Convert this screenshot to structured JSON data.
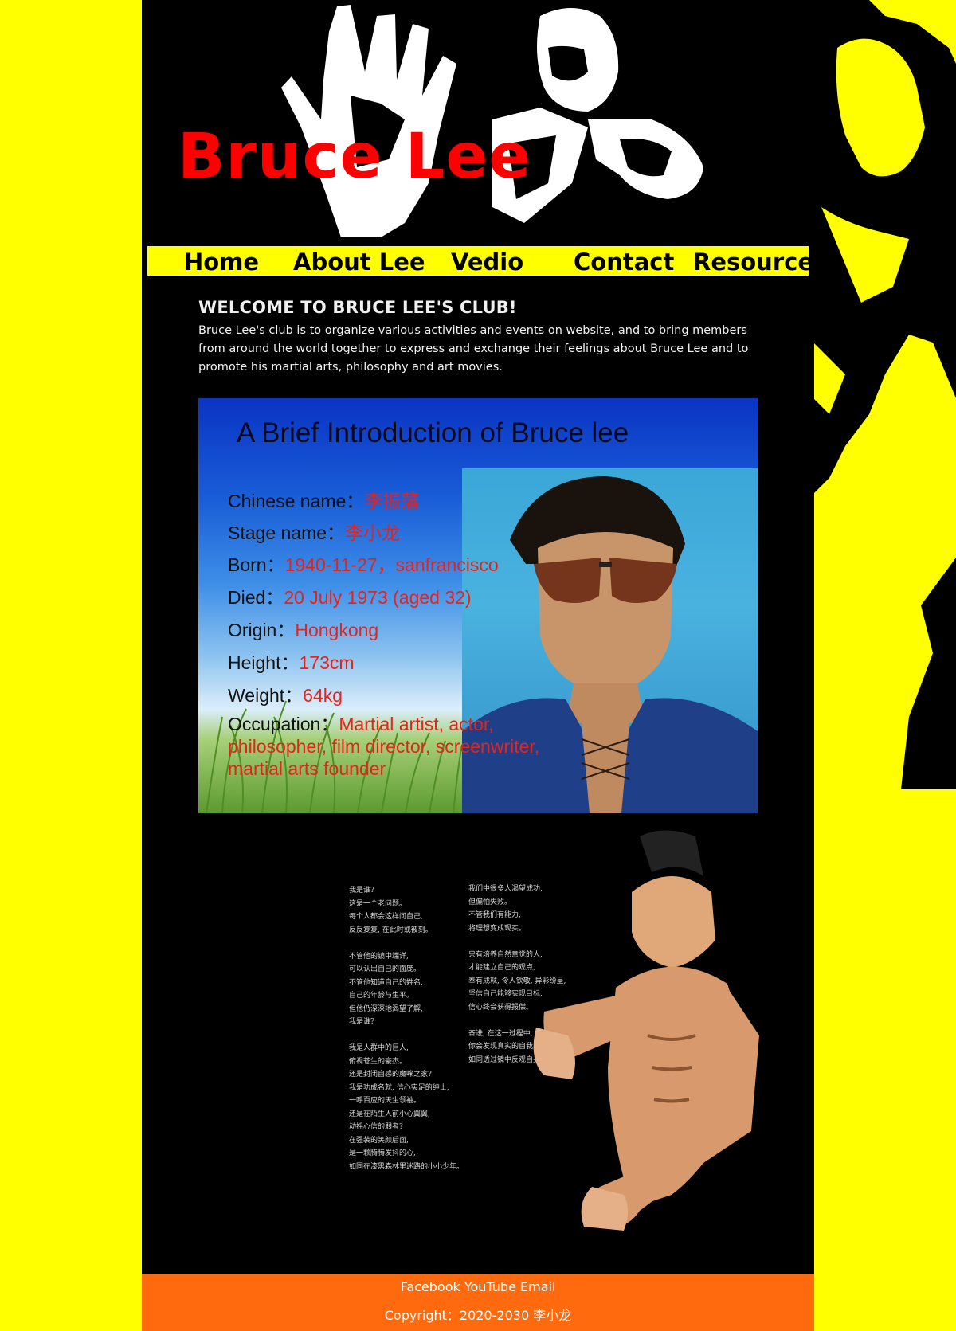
{
  "header": {
    "site_title": "Bruce Lee"
  },
  "nav": {
    "items": [
      {
        "label": "Home"
      },
      {
        "label": "About Lee"
      },
      {
        "label": "Vedio"
      },
      {
        "label": "Contact"
      },
      {
        "label": "Resources"
      }
    ]
  },
  "welcome": {
    "heading": "WELCOME TO BRUCE LEE'S CLUB!",
    "body": "Bruce Lee's club is to organize various activities and events on website, and to bring members from around the world together to express and exchange their feelings about Bruce Lee and to promote his martial arts, philosophy and art movies."
  },
  "intro_card": {
    "title": "A Brief Introduction of Bruce lee",
    "facts": [
      {
        "label": "Chinese name：",
        "value": "李振藩"
      },
      {
        "label": "Stage name：",
        "value": "李小龙"
      },
      {
        "label": "Born：",
        "value": "1940-11-27，sanfrancisco"
      },
      {
        "label": "Died：",
        "value": "20 July 1973 (aged 32)"
      },
      {
        "label": "Origin：",
        "value": "Hongkong"
      },
      {
        "label": "Height：",
        "value": "173cm"
      },
      {
        "label": "Weight：",
        "value": "64kg"
      }
    ],
    "occupation_label": "Occupation：",
    "occupation_value": "Martial artist, actor, philosopher, film director, screenwriter, martial arts founder"
  },
  "poem": {
    "col1": "我是谁?\n这是一个老问题。\n每个人都会这样问自己,\n反反复复, 在此时或彼刻。\n\n不管他的镜中端详,\n可以认出自己的面庞。\n不管他知道自己的姓名,\n自己的年龄与生平。\n但他仍深深地渴望了解,\n我是谁?\n\n我是人群中的巨人,\n俯视苍生的豪杰。\n还是封闭自感的魔咪之家?\n我是功成名就, 信心实足的绅士,\n一呼百应的天生领袖。\n还是在陌生人前小心翼翼,\n动摇心信的弱者?\n在强装的笑颜后面,\n是一颗腾腾发抖的心,\n如同在漆黑森林里迷路的小小少年。",
    "col2": "我们中很多人渴望成功,\n但偏怕失败。\n不管我们有能力,\n将理想变成现实。\n\n只有培养自然意觉的人,\n才能建立自己的观点,\n奉有成就, 令人钦敬, 异彩纷呈,\n坚信自己能够实现目标,\n信心终会获得报偿。\n\n奋进, 在这一过程中,\n你会发现真实的自我,\n如同透过镜中反观自身。"
  },
  "footer": {
    "links": [
      "Facebook",
      "YouTube",
      "Email"
    ],
    "copyright": "Copyright：2020-2030 李小龙"
  },
  "colors": {
    "page_bg": "#ffff00",
    "content_bg": "#000000",
    "title_red": "#ff0000",
    "nav_bg": "#ffff00",
    "footer_bg": "#ff6a0e"
  }
}
